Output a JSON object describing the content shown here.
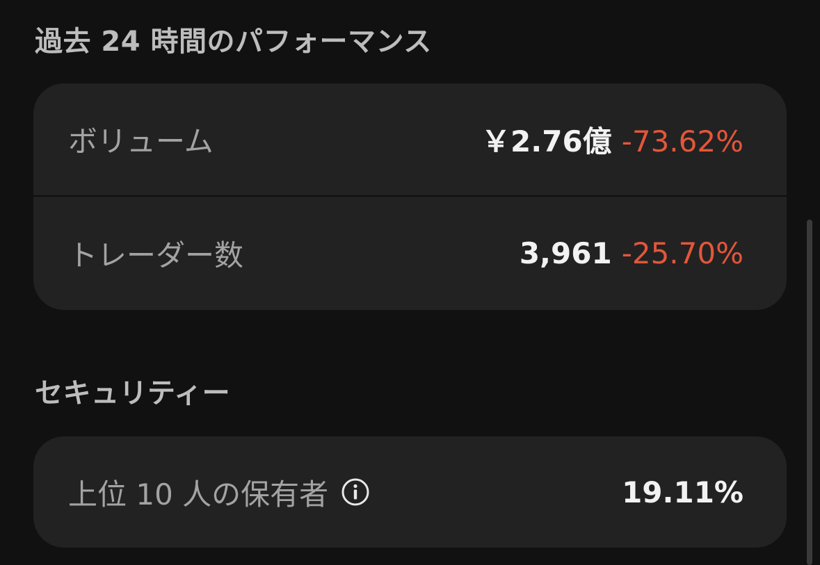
{
  "performance": {
    "title": "過去 24 時間のパフォーマンス",
    "rows": [
      {
        "label": "ボリューム",
        "value": "￥2.76億",
        "change": "-73.62%"
      },
      {
        "label": "トレーダー数",
        "value": "3,961",
        "change": "-25.70%"
      }
    ]
  },
  "security": {
    "title": "セキュリティー",
    "rows": [
      {
        "label": "上位 10 人の保有者",
        "value": "19.11%",
        "icon": "info-icon"
      }
    ]
  },
  "colors": {
    "background": "#111111",
    "card": "#222222",
    "negative_change": "#e4563a",
    "primary_text": "#f2f2f2",
    "secondary_text": "#a3a3a3"
  }
}
